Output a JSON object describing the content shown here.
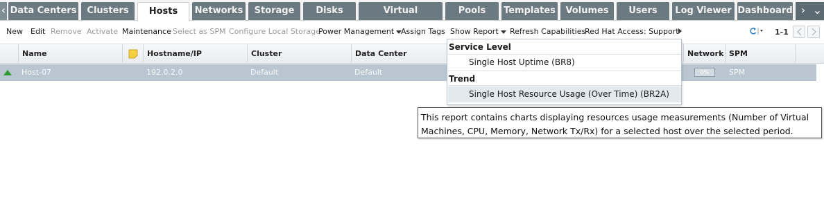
{
  "tabs": [
    {
      "label": "Data Centers",
      "active": false
    },
    {
      "label": "Clusters",
      "active": false
    },
    {
      "label": "Hosts",
      "active": true
    },
    {
      "label": "Networks",
      "active": false
    },
    {
      "label": "Storage",
      "active": false
    },
    {
      "label": "Disks",
      "active": false
    },
    {
      "label": "Virtual Machines",
      "active": false
    },
    {
      "label": "Pools",
      "active": false
    },
    {
      "label": "Templates",
      "active": false
    },
    {
      "label": "Volumes",
      "active": false
    },
    {
      "label": "Users",
      "active": false
    },
    {
      "label": "Log Viewer",
      "active": false
    },
    {
      "label": "Dashboard",
      "active": false
    }
  ],
  "tab_arrows": {
    "left": "‹",
    "right": "›",
    "right2": "⌄"
  },
  "toolbar": {
    "new": "New",
    "edit": "Edit",
    "remove": "Remove",
    "activate": "Activate",
    "maintenance": "Maintenance",
    "select_spm": "Select as SPM",
    "configure_storage": "Configure Local Storage",
    "power_management": "Power Management",
    "assign_tags": "Assign Tags",
    "show_report": "Show Report",
    "refresh_capabilities": "Refresh Capabilities",
    "red_hat_access": "Red Hat Access: Support"
  },
  "pager": {
    "count": "1-1"
  },
  "columns": {
    "name": "Name",
    "hostname": "Hostname/IP",
    "cluster": "Cluster",
    "datacenter": "Data Center",
    "network": "Network",
    "spm": "SPM"
  },
  "rows": [
    {
      "status": "up",
      "name": "Host-07",
      "hostname": "192.0.2.0",
      "cluster": "Default",
      "datacenter": "Default",
      "network": "0%",
      "spm": "SPM"
    }
  ],
  "report_menu": {
    "section1": "Service Level",
    "item1": "Single Host Uptime (BR8)",
    "section2": "Trend",
    "item2": "Single Host Resource Usage (Over Time) (BR2A)"
  },
  "tooltip": {
    "line1": "This report contains charts displaying resources usage measurements (Number of Virtual",
    "line2": "Machines, CPU, Memory, Network Tx/Rx) for a selected host over the selected period."
  },
  "colors": {
    "tab_bg": "#6b7980",
    "row_selected": "#b9c6d2",
    "status_up": "#2e9c2e"
  }
}
